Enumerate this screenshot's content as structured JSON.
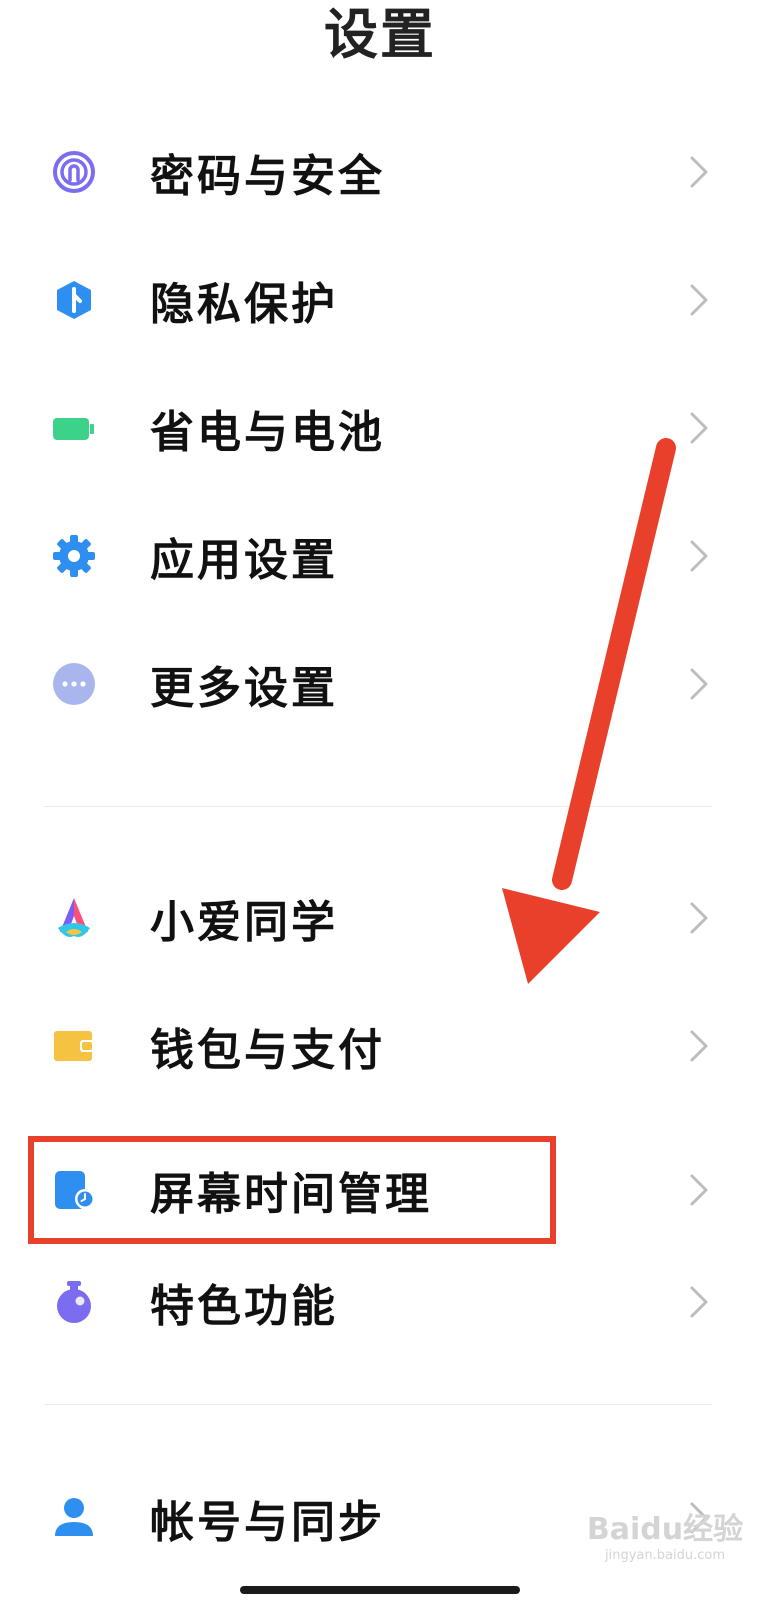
{
  "header": {
    "title": "设置"
  },
  "section1": [
    {
      "label": "密码与安全",
      "icon": "fingerprint-icon"
    },
    {
      "label": "隐私保护",
      "icon": "privacy-shield-icon"
    },
    {
      "label": "省电与电池",
      "icon": "battery-icon"
    },
    {
      "label": "应用设置",
      "icon": "gear-icon"
    },
    {
      "label": "更多设置",
      "icon": "more-dots-icon"
    }
  ],
  "section2": [
    {
      "label": "小爱同学",
      "icon": "xiaoai-icon"
    },
    {
      "label": "钱包与支付",
      "icon": "wallet-icon"
    },
    {
      "label": "屏幕时间管理",
      "icon": "screen-time-icon"
    },
    {
      "label": "特色功能",
      "icon": "features-icon"
    }
  ],
  "section3": [
    {
      "label": "帐号与同步",
      "icon": "account-icon"
    }
  ],
  "watermark": {
    "main": "Baidu经验",
    "sub": "jingyan.baidu.com"
  },
  "colors": {
    "annotation_red": "#e8402a",
    "text": "#111111",
    "chevron": "#bdbdbd"
  }
}
